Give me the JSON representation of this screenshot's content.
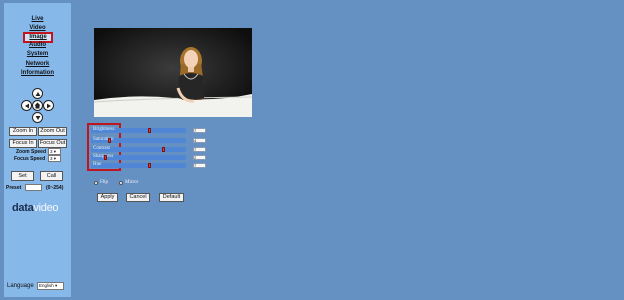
{
  "nav": {
    "items": [
      "Live",
      "Video",
      "Image",
      "Audio",
      "System",
      "Network",
      "Information"
    ],
    "selected": "Image"
  },
  "zoom": {
    "in": "Zoom In",
    "out": "Zoom Out"
  },
  "focus": {
    "in": "Focus In",
    "out": "Focus Out"
  },
  "zoom_speed": {
    "label": "Zoom Speed",
    "value": "3"
  },
  "focus_speed": {
    "label": "Focus Speed",
    "value": "3"
  },
  "preset": {
    "set": "Set",
    "call": "Call",
    "label": "Preset",
    "range": "(0~254)"
  },
  "logo": {
    "data": "data",
    "video": "video"
  },
  "language": {
    "label": "Language",
    "value": "English"
  },
  "image": {
    "sliders": [
      {
        "label": "Brightness",
        "value": 7,
        "fraction": 0.62
      },
      {
        "label": "Saturation",
        "value": 4,
        "fraction": 0.18
      },
      {
        "label": "Contrast",
        "value": 7,
        "fraction": 0.77
      },
      {
        "label": "Sharpness",
        "value": 2,
        "fraction": 0.14
      },
      {
        "label": "Hue",
        "value": 7,
        "fraction": 0.62
      }
    ],
    "flip_label": "Flip",
    "mirror_label": "Mirror",
    "apply": "Apply",
    "cancel": "Cancel",
    "default": "Default"
  },
  "colors": {
    "highlight": "#c0151f",
    "slider": "#4f87d6",
    "sidebar": "#87b8ea",
    "background": "#6590c2"
  },
  "icons": [
    "arrow-up-icon",
    "arrow-left-icon",
    "home-icon",
    "arrow-right-icon",
    "arrow-down-icon"
  ]
}
